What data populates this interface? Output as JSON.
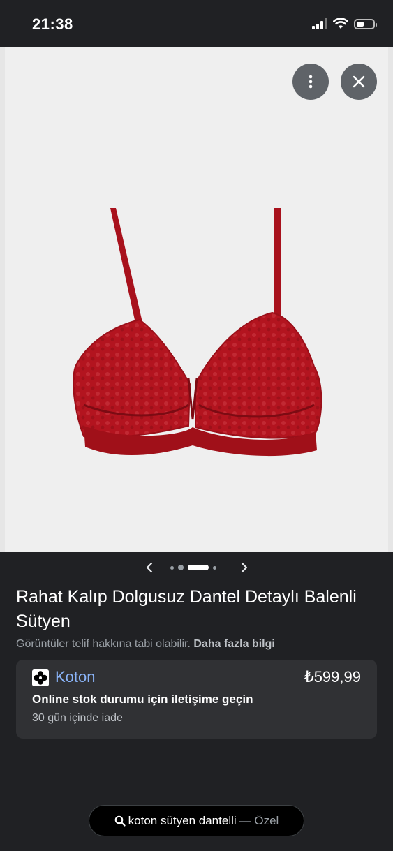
{
  "status_bar": {
    "time": "21:38",
    "battery_level": 0.45
  },
  "product": {
    "title": "Rahat Kalıp Dolgusuz Dantel Detaylı Balenli Sütyen",
    "copyright_notice": "Görüntüler telif hakkına tabi olabilir.",
    "more_info_link": "Daha fazla bilgi",
    "product_color": "#b3141f"
  },
  "carousel": {
    "total_images": 4,
    "active_index": 2
  },
  "merchant": {
    "name": "Koton",
    "price": "₺599,99",
    "stock_note": "Online stok durumu için iletişime geçin",
    "return_policy": "30 gün içinde iade"
  },
  "search_pill": {
    "query": "koton sütyen dantelli",
    "mode": "— Özel"
  },
  "icons": [
    "signal-icon",
    "wifi-icon",
    "battery-icon",
    "more-vert-icon",
    "close-icon",
    "chevron-left-icon",
    "chevron-right-icon",
    "koton-logo",
    "search-icon"
  ]
}
